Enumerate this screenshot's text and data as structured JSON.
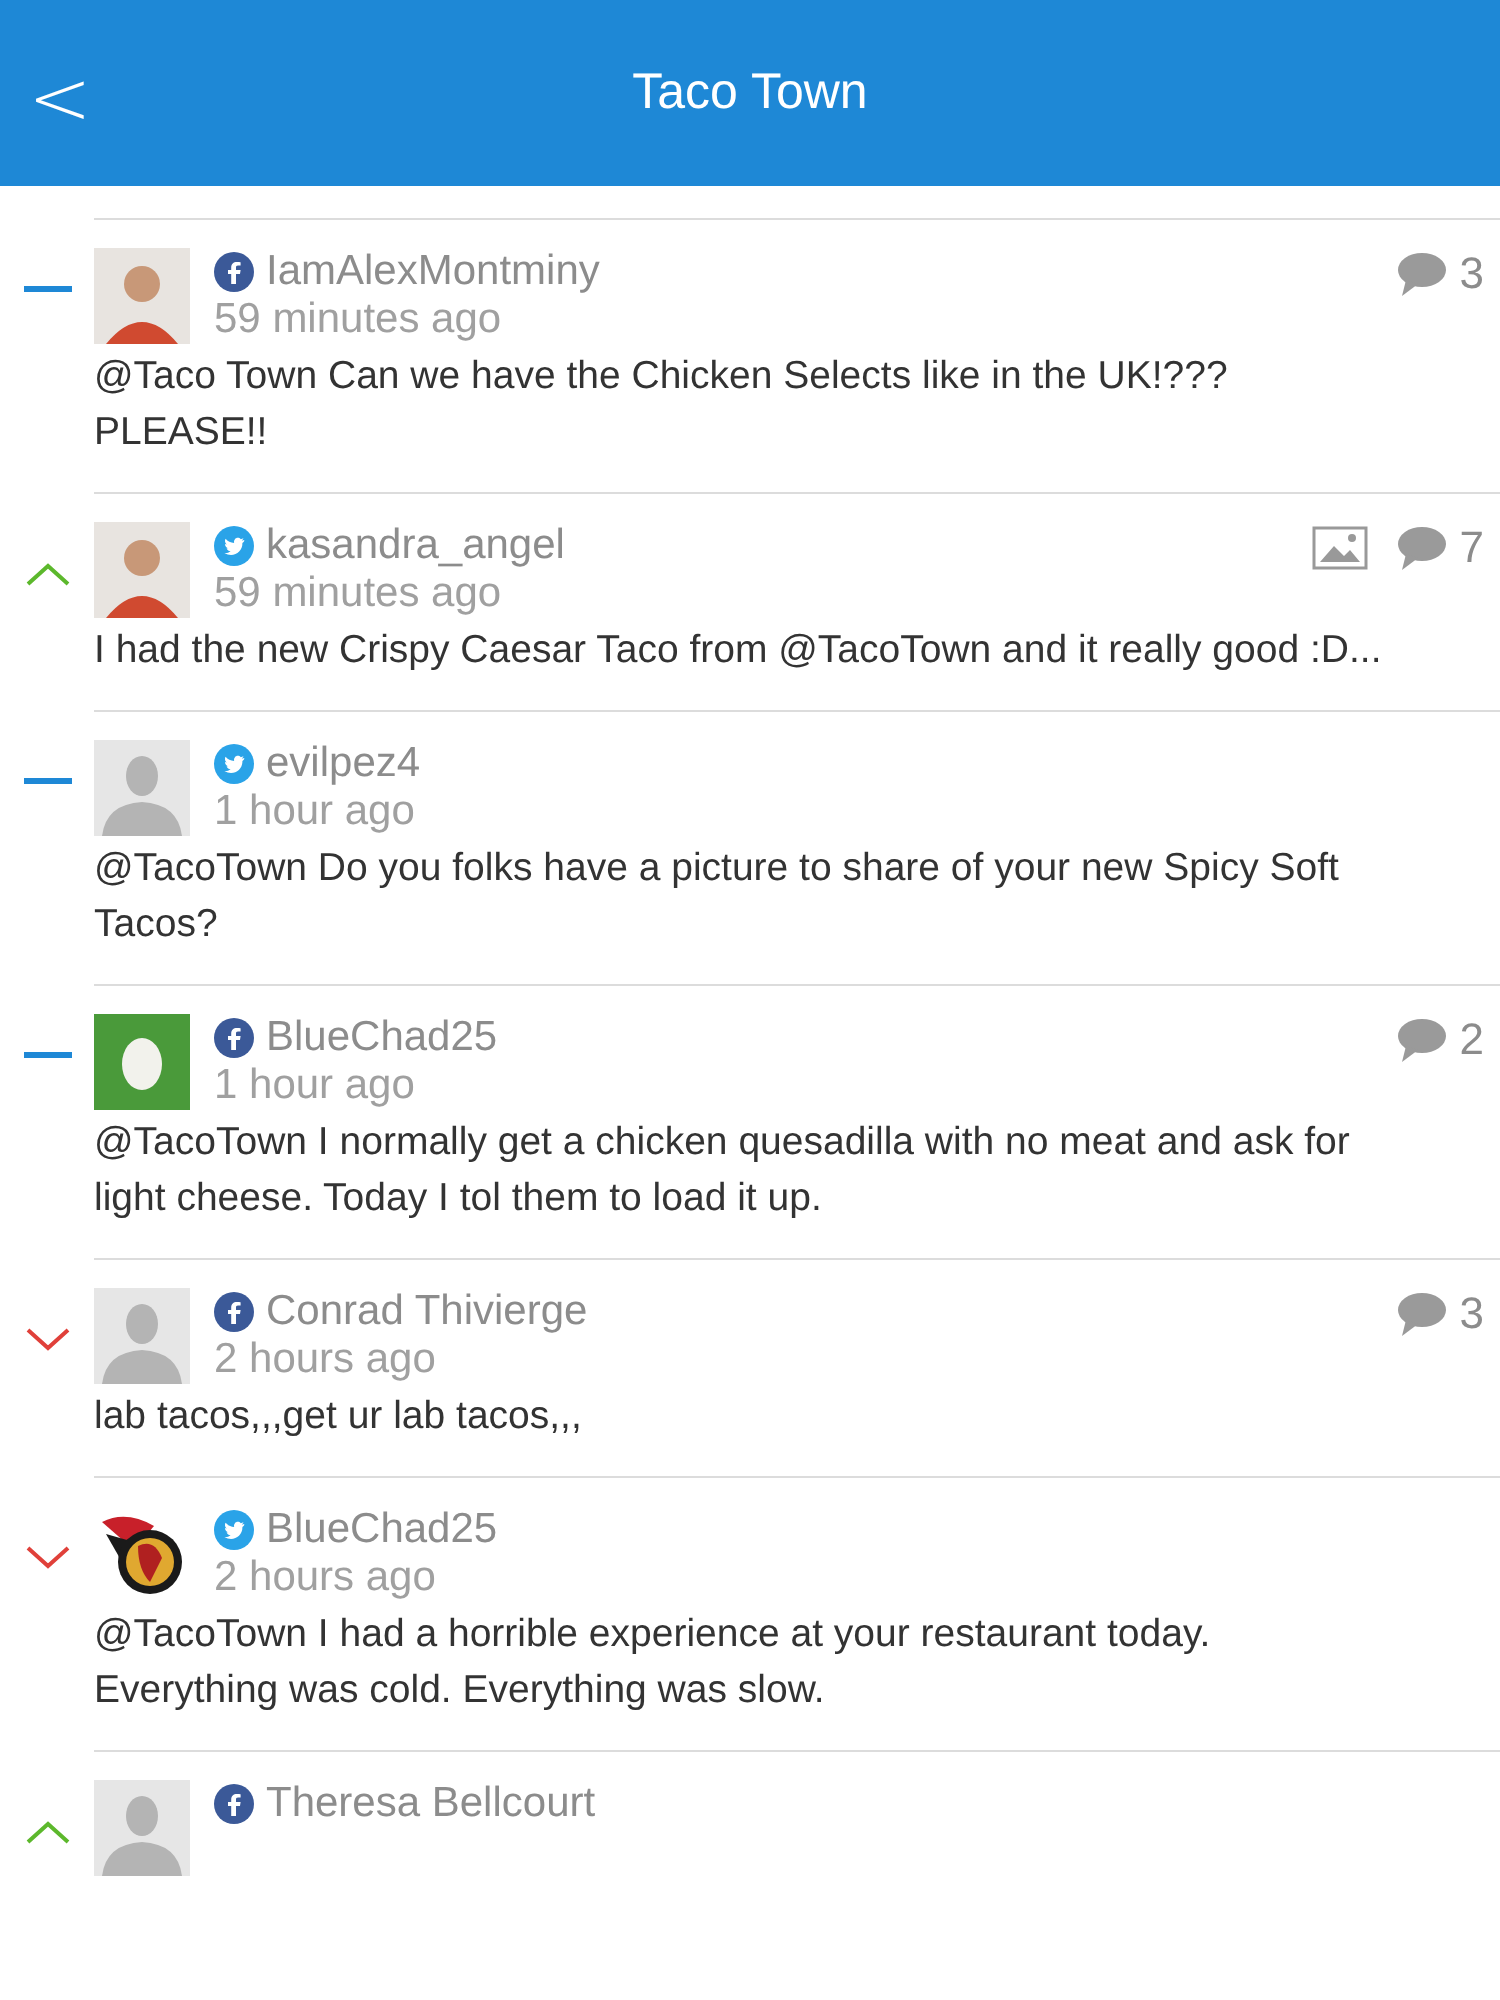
{
  "header": {
    "back": "<",
    "title": "Taco Town"
  },
  "posts": [
    {
      "sentiment": {
        "kind": "neutral"
      },
      "network": {
        "kind": "facebook"
      },
      "avatar": {
        "kind": "photo"
      },
      "name": "IamAlexMontminy",
      "time": "59 minutes ago",
      "text": "@Taco Town Can we have the Chicken Selects like in the UK!??? PLEASE!!",
      "has_image": false,
      "comments": "3"
    },
    {
      "sentiment": {
        "kind": "positive"
      },
      "network": {
        "kind": "twitter"
      },
      "avatar": {
        "kind": "photo"
      },
      "name": "kasandra_angel",
      "time": "59 minutes ago",
      "text": "I had the new Crispy Caesar Taco from @TacoTown and it really good :D...",
      "has_image": true,
      "comments": "7"
    },
    {
      "sentiment": {
        "kind": "neutral"
      },
      "network": {
        "kind": "twitter"
      },
      "avatar": {
        "kind": "placeholder"
      },
      "name": "evilpez4",
      "time": "1 hour ago",
      "text": "@TacoTown Do you folks have a picture to share of your new Spicy Soft Tacos?",
      "has_image": false
    },
    {
      "sentiment": {
        "kind": "neutral"
      },
      "network": {
        "kind": "facebook"
      },
      "avatar": {
        "kind": "egg"
      },
      "name": "BlueChad25",
      "time": "1 hour ago",
      "text": "@TacoTown I normally get a chicken quesadilla with no meat and ask for light cheese. Today I tol them to load it up.",
      "has_image": false,
      "comments": "2"
    },
    {
      "sentiment": {
        "kind": "negative"
      },
      "network": {
        "kind": "facebook"
      },
      "avatar": {
        "kind": "placeholder"
      },
      "name": "Conrad Thivierge",
      "time": "2 hours ago",
      "text": "lab tacos,,,get ur lab tacos,,,",
      "has_image": false,
      "comments": "3"
    },
    {
      "sentiment": {
        "kind": "negative"
      },
      "network": {
        "kind": "twitter"
      },
      "avatar": {
        "kind": "logo"
      },
      "name": "BlueChad25",
      "time": "2 hours ago",
      "text": "@TacoTown I had a horrible experience at your restaurant today. Everything was cold. Everything was slow.",
      "has_image": false
    },
    {
      "sentiment": {
        "kind": "positive"
      },
      "network": {
        "kind": "facebook"
      },
      "avatar": {
        "kind": "placeholder"
      },
      "name": "Theresa Bellcourt"
    }
  ]
}
